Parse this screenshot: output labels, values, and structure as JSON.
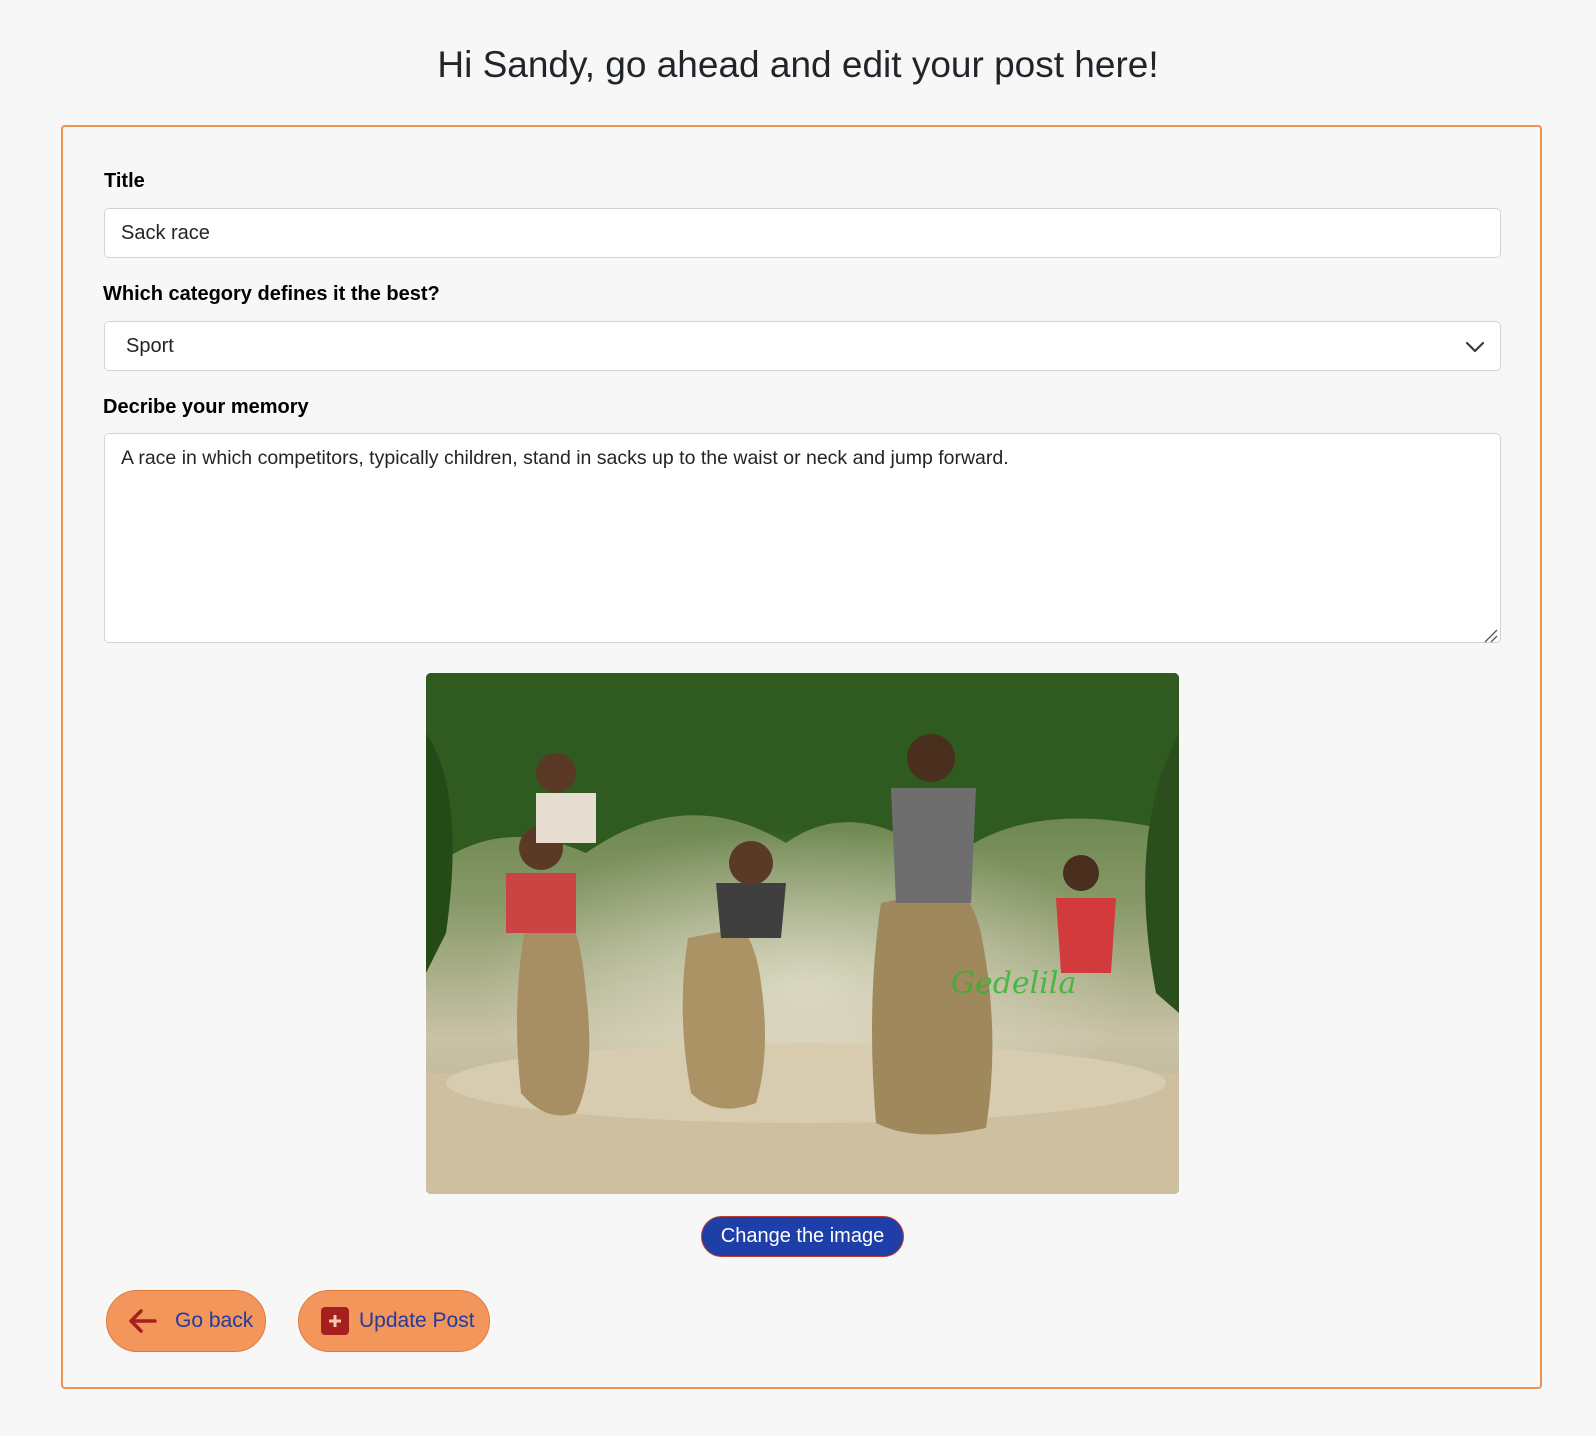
{
  "page": {
    "heading": "Hi Sandy, go ahead and edit your post here!"
  },
  "form": {
    "title_label": "Title",
    "title_value": "Sack race",
    "category_label": "Which category defines it the best?",
    "category_value": "Sport",
    "description_label": "Decribe your memory",
    "description_value": "A race in which competitors, typically children, stand in sacks up to the waist or neck and jump forward."
  },
  "image": {
    "watermark": "Gedelila",
    "change_label": "Change the image"
  },
  "actions": {
    "go_back_label": "Go back",
    "update_label": "Update Post"
  },
  "colors": {
    "card_border": "#f0914f",
    "pill_button": "#f3965c",
    "pill_text": "#233a9e",
    "change_button": "#1f3fa8",
    "icon_red": "#a51f1f"
  },
  "icons": {
    "select": "chevron-down-icon",
    "go_back": "arrow-left-icon",
    "update": "plus-square-icon"
  }
}
